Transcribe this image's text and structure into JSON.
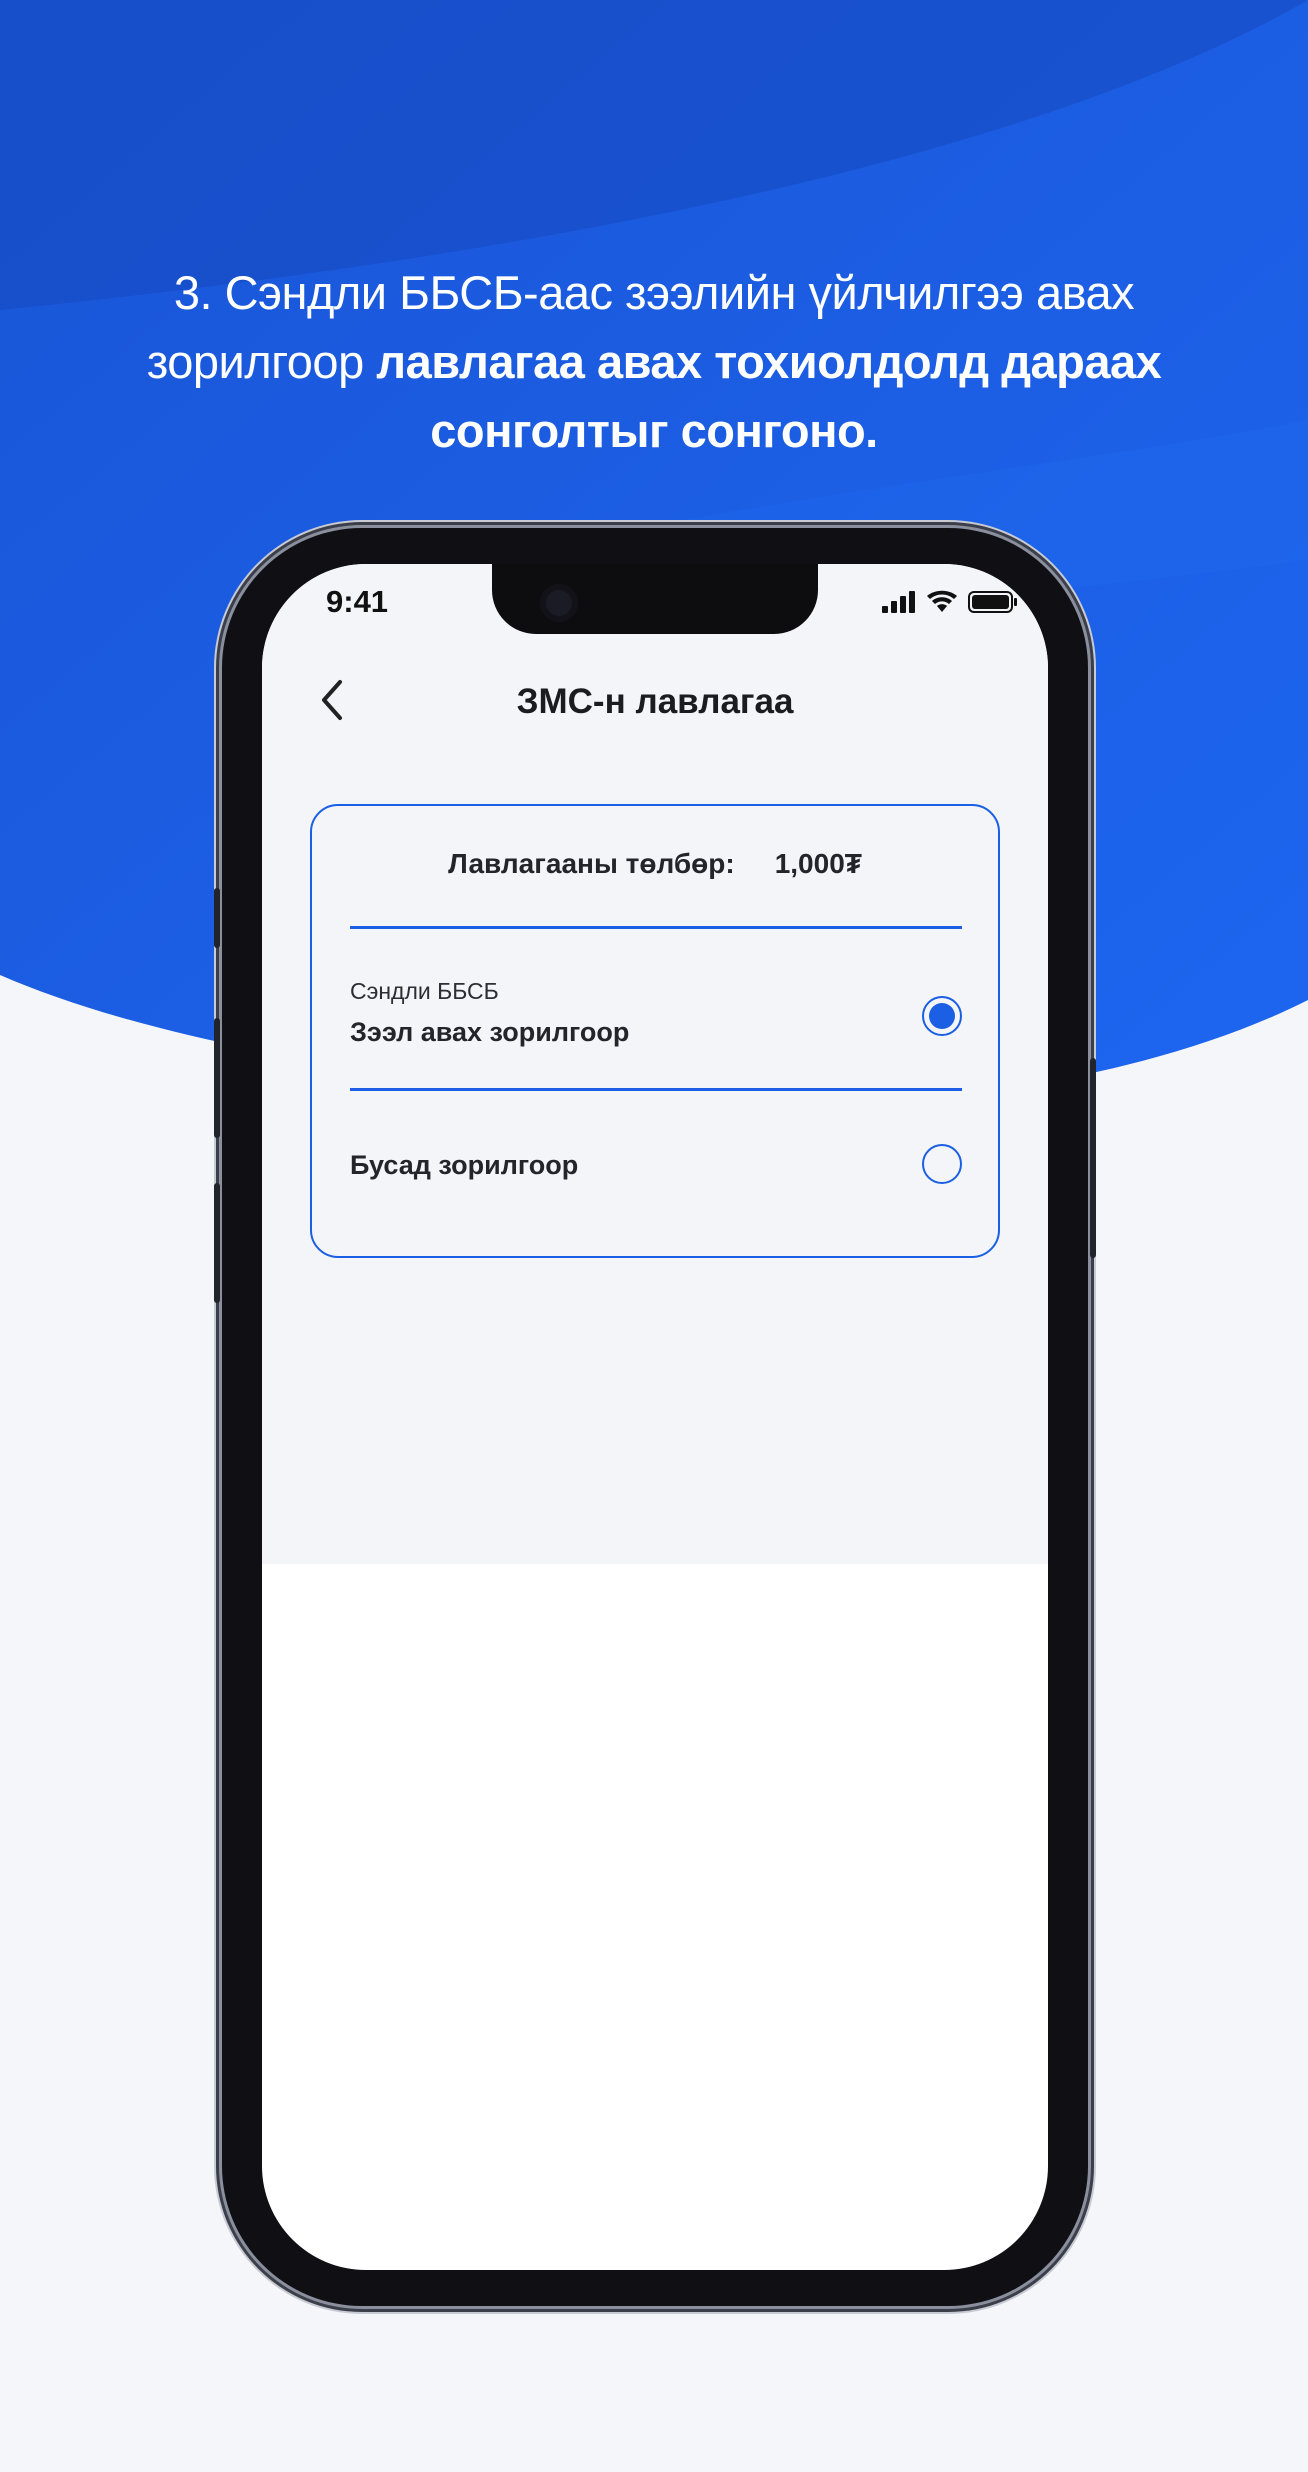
{
  "caption": {
    "line1": "3.  Сэндли ББСБ-аас зээлийн үйлчилгээ авах",
    "line2_light": "зорилгоор ",
    "line2_bold": "лавлагаа авах тохиолдолд    дараах",
    "line3_bold": "сонголтыг сонгоно."
  },
  "status_bar": {
    "time": "9:41",
    "icons": [
      "signal-icon",
      "wifi-icon",
      "battery-icon"
    ]
  },
  "nav": {
    "back_icon": "chevron-left-icon",
    "title": "ЗМС-н лавлагаа"
  },
  "card": {
    "fee_label": "Лавлагааны төлбөр:",
    "fee_value": "1,000₮",
    "options": [
      {
        "subtitle": "Сэндли ББСБ",
        "label": "Зээл авах зорилгоор",
        "selected": true
      },
      {
        "subtitle": "",
        "label": "Бусад зорилгоор",
        "selected": false
      }
    ]
  },
  "colors": {
    "accent": "#1a5fe4",
    "background_blue": "#1a5fe4",
    "page_background": "#f4f6fa"
  }
}
